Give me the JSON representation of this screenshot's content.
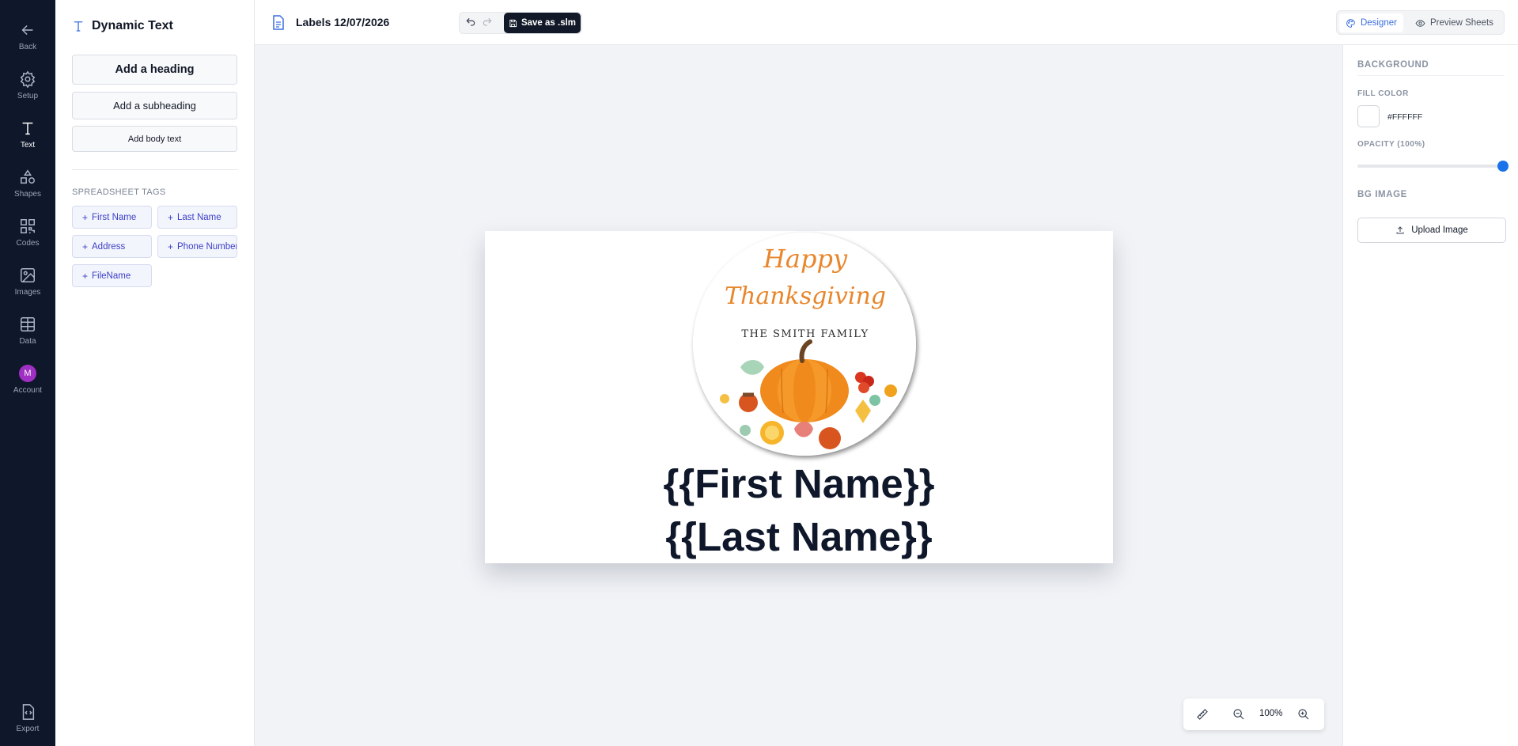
{
  "rail": {
    "back": "Back",
    "setup": "Setup",
    "text": "Text",
    "shapes": "Shapes",
    "codes": "Codes",
    "images": "Images",
    "data": "Data",
    "account": "Account",
    "account_initial": "M",
    "export": "Export"
  },
  "panel": {
    "title": "Dynamic Text",
    "add_heading": "Add a heading",
    "add_subheading": "Add a subheading",
    "add_body": "Add body text",
    "tags_label": "SPREADSHEET TAGS",
    "tags": [
      "First Name",
      "Last Name",
      "Address",
      "Phone Number",
      "FileName"
    ]
  },
  "topbar": {
    "doc_title": "Labels 12/07/2026",
    "save_label": "Save as .slm",
    "designer": "Designer",
    "preview": "Preview Sheets"
  },
  "canvas": {
    "sticker_line1": "Happy",
    "sticker_line2": "Thanksgiving",
    "sticker_line3": "The Smith Family",
    "first_name": "{{First Name}}",
    "last_name": "{{Last Name}}"
  },
  "zoom": {
    "value": "100%"
  },
  "props": {
    "background": "BACKGROUND",
    "fill_color": "FILL COLOR",
    "fill_hex": "#FFFFFF",
    "opacity": "OPACITY (100%)",
    "opacity_value": 1.0,
    "bg_image": "BG IMAGE",
    "upload": "Upload Image"
  },
  "colors": {
    "rail_bg": "#0f172a",
    "accent": "#3b6fe0",
    "tag_text": "#3b3fc4",
    "slider": "#1a73e8",
    "sticker_orange": "#e8862b"
  }
}
